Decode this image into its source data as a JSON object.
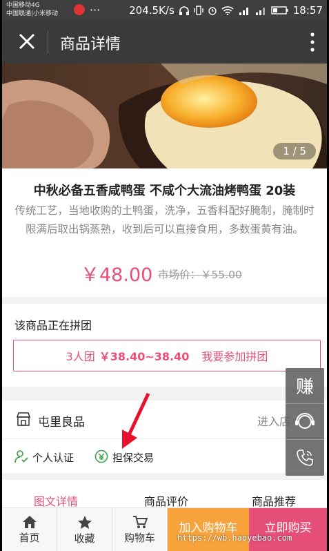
{
  "status_bar": {
    "carrier_1": "中国移动4G",
    "carrier_2": "中国联通|小米移动",
    "dots": "···",
    "speed": "204.5K/s",
    "time": "18:57"
  },
  "header": {
    "title": "商品详情"
  },
  "gallery": {
    "counter": "1 / 5"
  },
  "product": {
    "title": "中秋必备五香咸鸭蛋 不咸个大流油烤鸭蛋 20装",
    "description": "传统工艺，当地收购的土鸭蛋，洗净，五香料配好腌制，腌制时限满后取出锅蒸熟，收到后可以直接食用，多数蛋黄有油。",
    "price": "￥48.00",
    "market_price": "市场价：￥55.00"
  },
  "group_buy": {
    "title": "该商品正在拼团",
    "size": "3人团",
    "price_range": "￥38.40~38.40",
    "action": "我要参加拼团"
  },
  "shop": {
    "name": "屯里良品",
    "enter": "进入店",
    "badge_1": "个人认证",
    "badge_2": "担保交易"
  },
  "tabs": {
    "details": "图文详情",
    "reviews": "商品评价",
    "recommend": "商品推荐"
  },
  "side_menu": {
    "earn": "赚"
  },
  "bottom_bar": {
    "home": "首页",
    "favorite": "收藏",
    "cart": "购物车",
    "add_to_cart": "加入购物车",
    "buy_now": "立即购买",
    "watermark": "https://wb.haoyebao.com"
  },
  "colors": {
    "accent_pink": "#e64f78",
    "accent_orange": "#f7a23b",
    "header_bg": "#3a3a3a"
  }
}
